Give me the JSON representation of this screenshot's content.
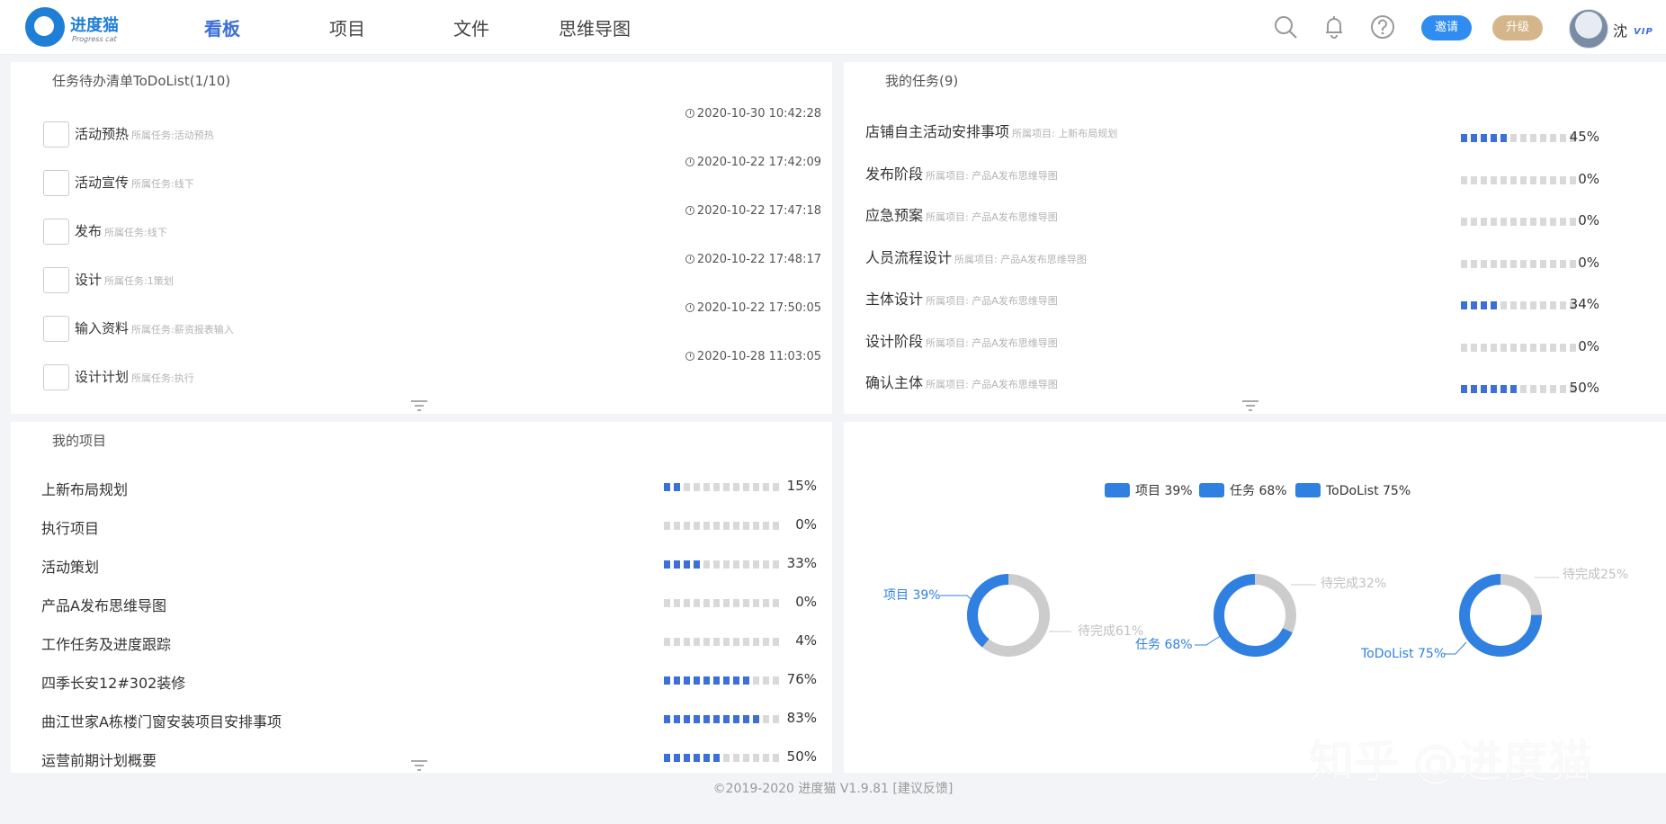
{
  "app": {
    "name": "进度猫",
    "sub": "Progress cat"
  },
  "nav": [
    "看板",
    "项目",
    "文件",
    "思维导图"
  ],
  "header": {
    "invite": "邀请",
    "upgrade": "升级",
    "user": "沈",
    "vip": "VIP"
  },
  "todo": {
    "title": "任务待办清单ToDoList(1/10)",
    "items": [
      {
        "name": "活动预热",
        "sub": "所属任务:活动预热",
        "time": "2020-10-30 10:42:28"
      },
      {
        "name": "活动宣传",
        "sub": "所属任务:线下",
        "time": "2020-10-22 17:42:09"
      },
      {
        "name": "发布",
        "sub": "所属任务:线下",
        "time": "2020-10-22 17:47:18"
      },
      {
        "name": "设计",
        "sub": "所属任务:1策划",
        "time": "2020-10-22 17:48:17"
      },
      {
        "name": "输入资料",
        "sub": "所属任务:薪资报表输入",
        "time": "2020-10-22 17:50:05"
      },
      {
        "name": "设计计划",
        "sub": "所属任务:执行",
        "time": "2020-10-28 11:03:05"
      }
    ]
  },
  "tasks": {
    "title": "我的任务(9)",
    "items": [
      {
        "name": "店铺自主活动安排事项",
        "sub": "所属项目: 上新布局规划",
        "pct_label": "45%",
        "progress": 45
      },
      {
        "name": "发布阶段",
        "sub": "所属项目: 产品A发布思维导图",
        "pct_label": "0%",
        "progress": 0
      },
      {
        "name": "应急预案",
        "sub": "所属项目: 产品A发布思维导图",
        "pct_label": "0%",
        "progress": 0
      },
      {
        "name": "人员流程设计",
        "sub": "所属项目: 产品A发布思维导图",
        "pct_label": "0%",
        "progress": 0
      },
      {
        "name": "主体设计",
        "sub": "所属项目: 产品A发布思维导图",
        "pct_label": "34%",
        "progress": 34
      },
      {
        "name": "设计阶段",
        "sub": "所属项目: 产品A发布思维导图",
        "pct_label": "0%",
        "progress": 0
      },
      {
        "name": "确认主体",
        "sub": "所属项目: 产品A发布思维导图",
        "pct_label": "50%",
        "progress": 50
      }
    ]
  },
  "projects": {
    "title": "我的项目",
    "items": [
      {
        "name": "上新布局规划",
        "pct_label": "15%",
        "progress": 15
      },
      {
        "name": "执行项目",
        "pct_label": "0%",
        "progress": 0
      },
      {
        "name": "活动策划",
        "pct_label": "33%",
        "progress": 33
      },
      {
        "name": "产品A发布思维导图",
        "pct_label": "0%",
        "progress": 0
      },
      {
        "name": "工作任务及进度跟踪",
        "pct_label": "4%",
        "progress": 4
      },
      {
        "name": "四季长安12#302装修",
        "pct_label": "76%",
        "progress": 76
      },
      {
        "name": "曲江世家A栋楼门窗安装项目安排事项",
        "pct_label": "83%",
        "progress": 83
      },
      {
        "name": "运营前期计划概要",
        "pct_label": "50%",
        "progress": 50
      }
    ]
  },
  "chart_data": {
    "type": "pie",
    "legend": [
      "项目 39%",
      "任务 68%",
      "ToDoList 75%"
    ],
    "legend_position": "top",
    "donuts": [
      {
        "label": "项目 39%",
        "value": 39,
        "rest_label": "待完成61%",
        "rest": 61
      },
      {
        "label": "任务 68%",
        "value": 68,
        "rest_label": "待完成32%",
        "rest": 32
      },
      {
        "label": "ToDoList 75%",
        "value": 75,
        "rest_label": "待完成25%",
        "rest": 25
      }
    ],
    "colors": {
      "done": "#2f80e1",
      "rest": "#cccccc"
    }
  },
  "footer": {
    "text": "©2019-2020 进度猫 V1.9.81",
    "feedback": "[建议反馈]"
  },
  "watermark": "知乎 @进度猫"
}
